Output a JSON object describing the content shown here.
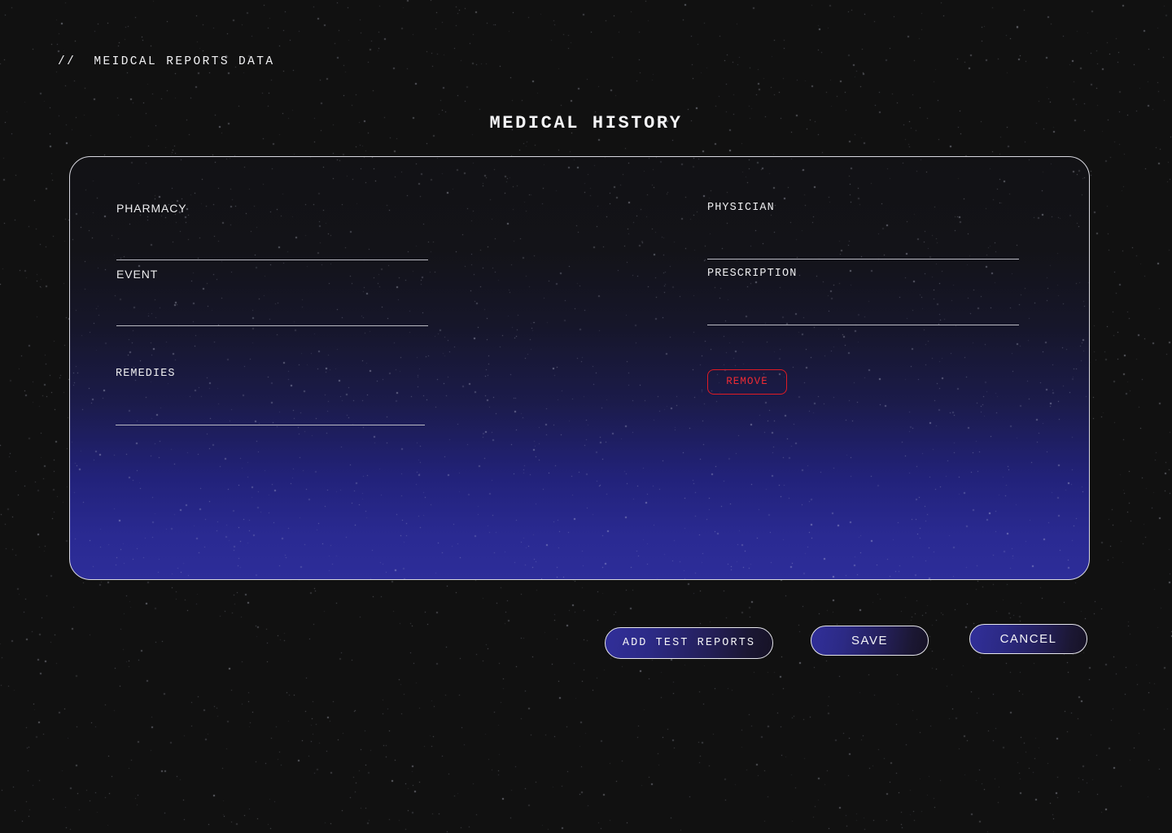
{
  "breadcrumb": {
    "text": "//  MEIDCAL REPORTS DATA"
  },
  "page": {
    "title": "MEDICAL HISTORY"
  },
  "form": {
    "fields": [
      {
        "key": "pharmacy",
        "label": "PHARMACY",
        "value": "",
        "placeholder": ""
      },
      {
        "key": "event",
        "label": "EVENT",
        "value": "",
        "placeholder": ""
      },
      {
        "key": "remedies",
        "label": "REMEDIES",
        "value": "",
        "placeholder": ""
      },
      {
        "key": "physician",
        "label": "PHYSICIAN",
        "value": "",
        "placeholder": ""
      },
      {
        "key": "prescription",
        "label": "PRESCRIPTION",
        "value": "",
        "placeholder": ""
      }
    ],
    "remove_label": "REMOVE"
  },
  "actions": {
    "add_test_reports_label": "ADD TEST REPORTS",
    "save_label": "SAVE",
    "cancel_label": "CANCEL"
  },
  "colors": {
    "background": "#111111",
    "panel_top": "#121215",
    "panel_bottom": "#2d2d99",
    "accent_danger": "#ef2b33",
    "border": "#d8d8e0",
    "text": "#f2f2f4"
  }
}
